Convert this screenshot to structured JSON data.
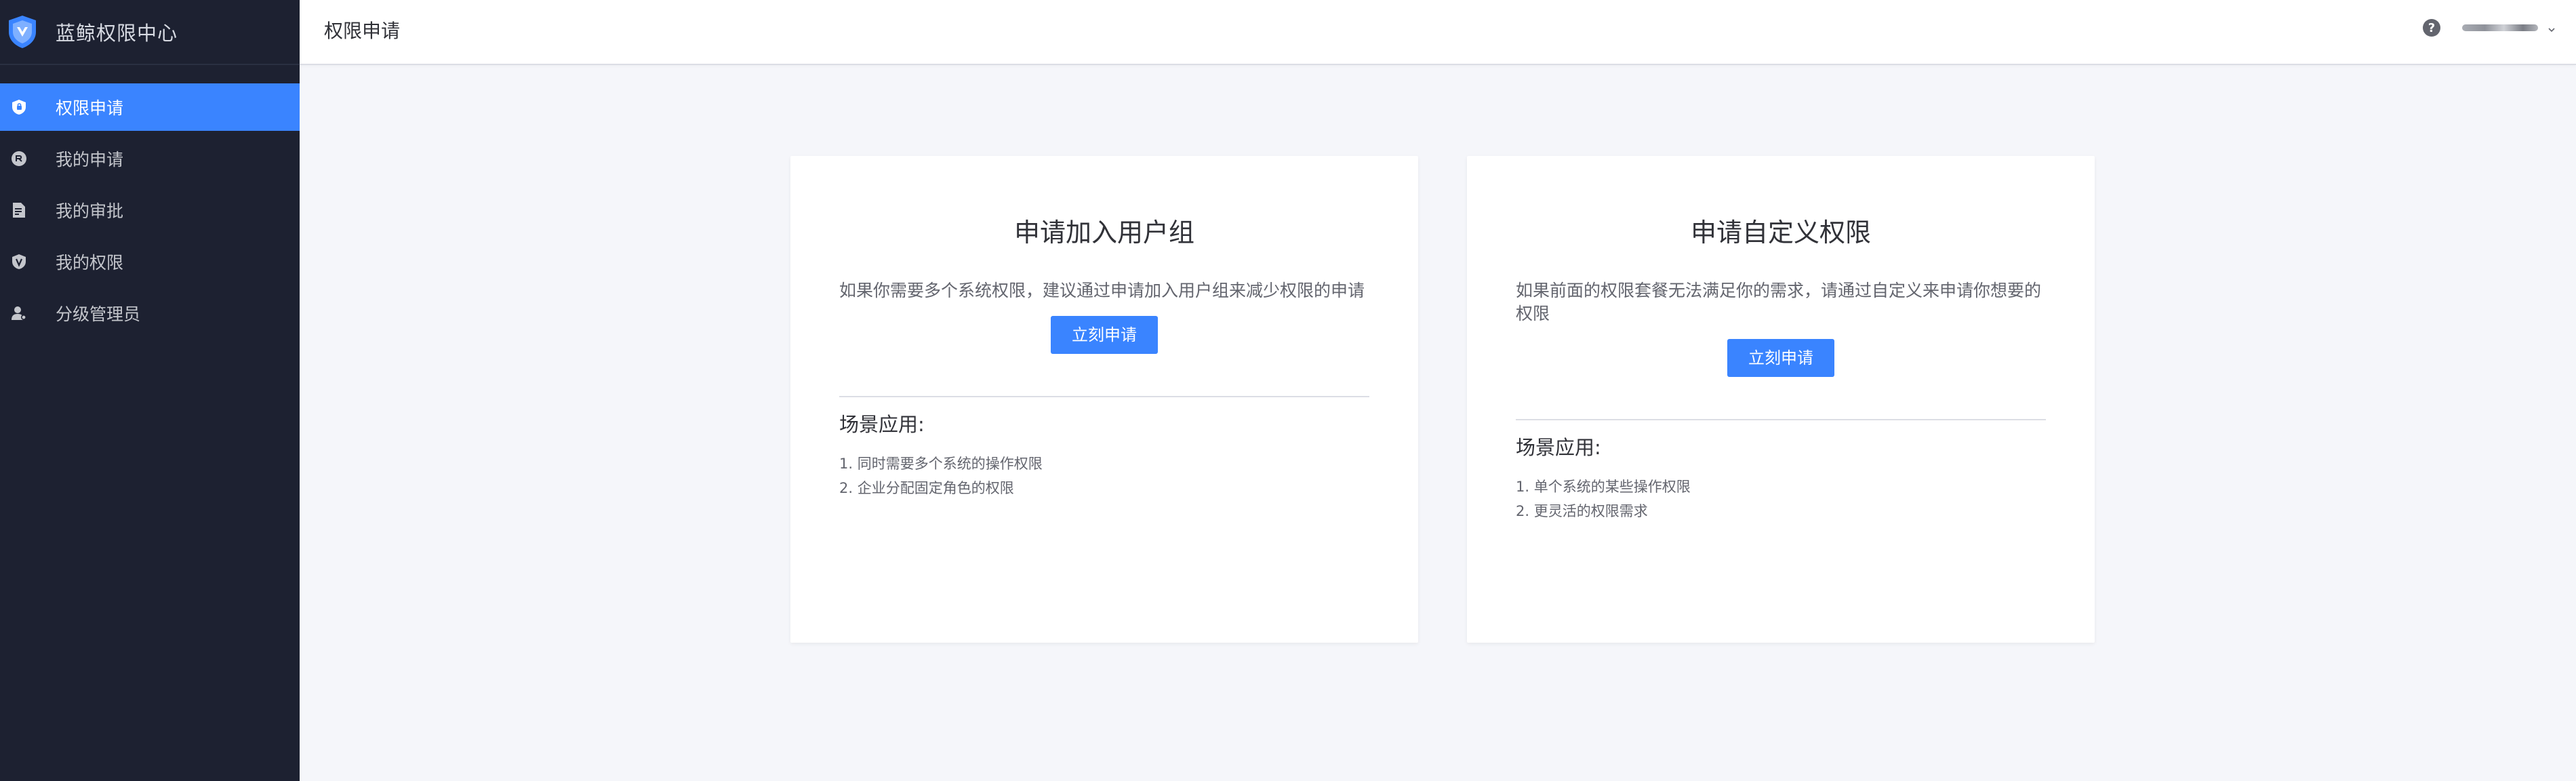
{
  "app": {
    "title": "蓝鲸权限中心"
  },
  "sidebar": {
    "items": [
      {
        "label": "权限申请",
        "icon": "shield-lock-icon",
        "active": true
      },
      {
        "label": "我的申请",
        "icon": "apply-icon",
        "active": false
      },
      {
        "label": "我的审批",
        "icon": "approval-icon",
        "active": false
      },
      {
        "label": "我的权限",
        "icon": "permission-icon",
        "active": false
      },
      {
        "label": "分级管理员",
        "icon": "admin-user-icon",
        "active": false
      }
    ]
  },
  "header": {
    "page_title": "权限申请",
    "help_symbol": "?",
    "user_name": ""
  },
  "cards": {
    "left": {
      "title": "申请加入用户组",
      "description": "如果你需要多个系统权限，建议通过申请加入用户组来减少权限的申请",
      "button_label": "立刻申请",
      "scenario_title": "场景应用:",
      "scenarios": [
        "1. 同时需要多个系统的操作权限",
        "2. 企业分配固定角色的权限"
      ]
    },
    "right": {
      "title": "申请自定义权限",
      "description": "如果前面的权限套餐无法满足你的需求，请通过自定义来申请你想要的权限",
      "button_label": "立刻申请",
      "scenario_title": "场景应用:",
      "scenarios": [
        "1. 单个系统的某些操作权限",
        "2. 更灵活的权限需求"
      ]
    }
  },
  "colors": {
    "sidebar_bg": "#1d2131",
    "accent": "#3a84ff",
    "page_bg": "#f5f6fa"
  }
}
